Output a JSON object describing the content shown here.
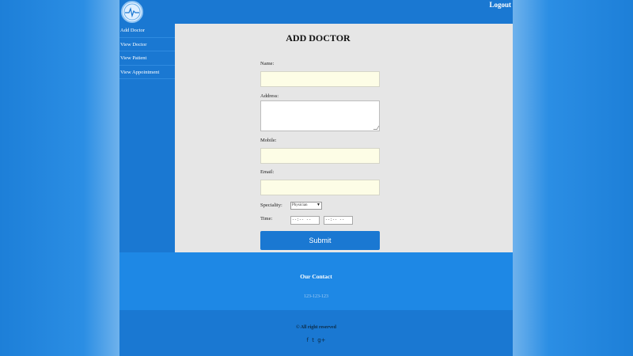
{
  "header": {
    "logout_label": "Logout"
  },
  "sidebar": {
    "items": [
      {
        "label": "Add Doctor"
      },
      {
        "label": "View Doctor"
      },
      {
        "label": "View Patient"
      },
      {
        "label": "View Appointment"
      }
    ]
  },
  "form": {
    "title": "ADD DOCTOR",
    "name_label": "Name:",
    "address_label": "Address:",
    "mobile_label": "Mobile:",
    "email_label": "Email:",
    "specialty_label": "Speciality:",
    "specialty_value": "Physician",
    "time_label": "Time:",
    "time_from_placeholder": "--:-- --",
    "time_to_placeholder": "--:-- --",
    "submit_label": "Submit"
  },
  "contact": {
    "title": "Our Contact",
    "phone": "123-123-123"
  },
  "footer": {
    "copyright": "© All right reserved",
    "social": [
      {
        "icon": "facebook-icon",
        "glyph": "f"
      },
      {
        "icon": "twitter-icon",
        "glyph": "t"
      },
      {
        "icon": "google-plus-icon",
        "glyph": "g+"
      }
    ]
  },
  "colors": {
    "brand_blue": "#1a78d2",
    "content_bg": "#e6e6e6",
    "input_bg": "#fdfde6"
  }
}
